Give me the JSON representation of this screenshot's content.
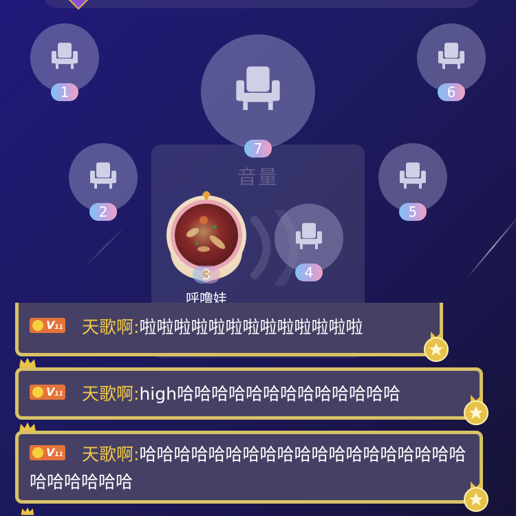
{
  "seats": [
    {
      "number": "1"
    },
    {
      "number": "6"
    },
    {
      "number": "7"
    },
    {
      "number": "2"
    },
    {
      "number": "5"
    },
    {
      "number": "4"
    }
  ],
  "occupied_seat": {
    "user_name": "呼噜娃",
    "number": "3"
  },
  "volume_overlay": {
    "title": "音量"
  },
  "chat": [
    {
      "sender": "天歌啊:",
      "message": "啦啦啦啦啦啦啦啦啦啦啦啦啦",
      "level": "V",
      "level_sub": "11"
    },
    {
      "sender": "天歌啊:",
      "message": "high哈哈哈哈哈哈哈哈哈哈哈哈哈",
      "level": "V",
      "level_sub": "11"
    },
    {
      "sender": "天歌啊:",
      "message": "哈哈哈哈哈哈哈哈哈哈哈哈哈哈哈哈哈哈哈哈哈哈哈哈哈",
      "level": "V",
      "level_sub": "11"
    }
  ],
  "colors": {
    "accent_gold": "#f1c94a",
    "chat_border": "#d8c266",
    "background": "#1d1a62"
  }
}
